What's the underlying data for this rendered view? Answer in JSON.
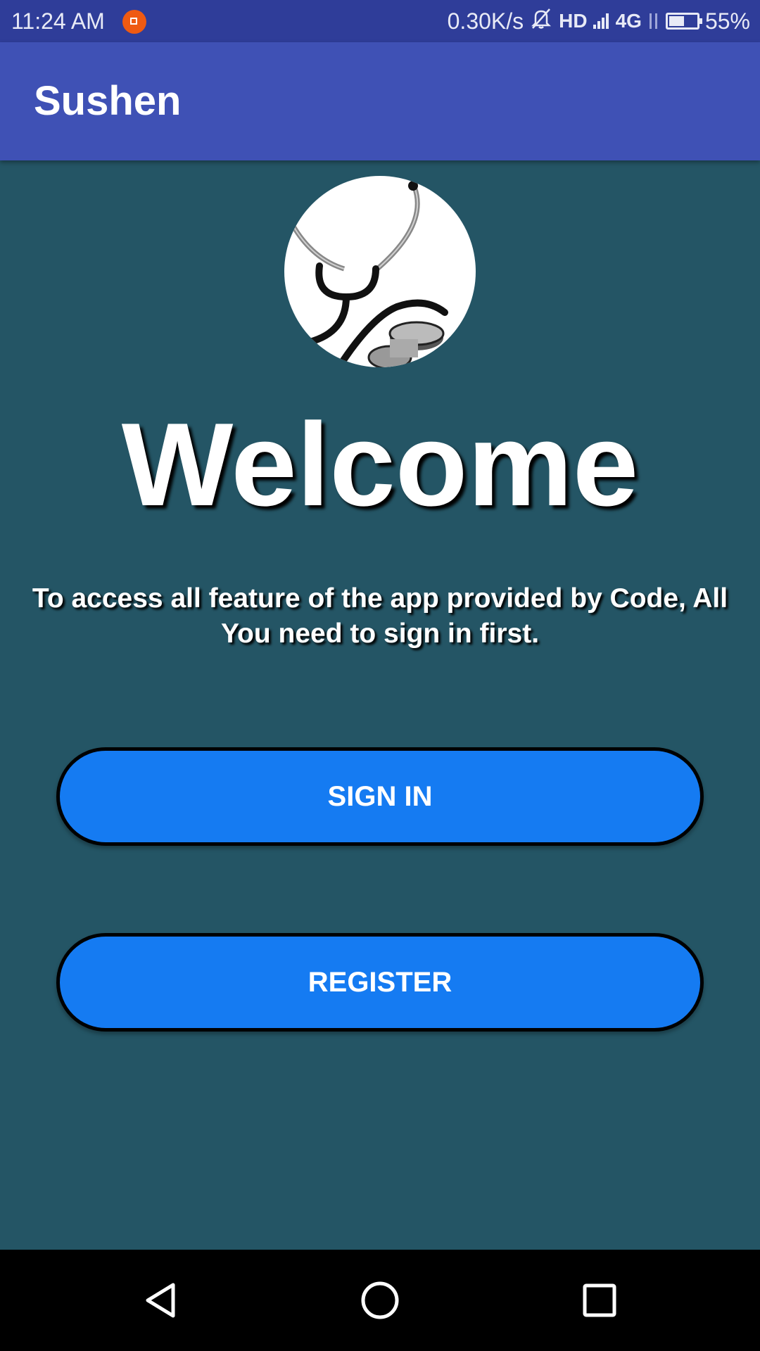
{
  "status_bar": {
    "time": "11:24 AM",
    "net_speed": "0.30K/s",
    "hd": "HD",
    "network": "4G",
    "battery_percent": "55%",
    "battery_level": 0.55,
    "icons": [
      "app-notification-icon",
      "mute-icon",
      "signal-icon",
      "data-arrows-icon",
      "battery-icon"
    ]
  },
  "app_bar": {
    "title": "Sushen"
  },
  "main": {
    "logo_icon": "stethoscope-icon",
    "welcome": "Welcome",
    "subtitle": "To access all feature of the app provided by Code, All You need to sign in first.",
    "sign_in_label": "SIGN IN",
    "register_label": "REGISTER"
  },
  "nav_bar": {
    "icons": [
      "back-icon",
      "home-icon",
      "recents-icon"
    ]
  },
  "colors": {
    "status_bar": "#2f3d99",
    "app_bar": "#3f51b5",
    "background": "#245565",
    "button": "#157bf2",
    "button_border": "#000000",
    "nav_bar": "#000000"
  }
}
